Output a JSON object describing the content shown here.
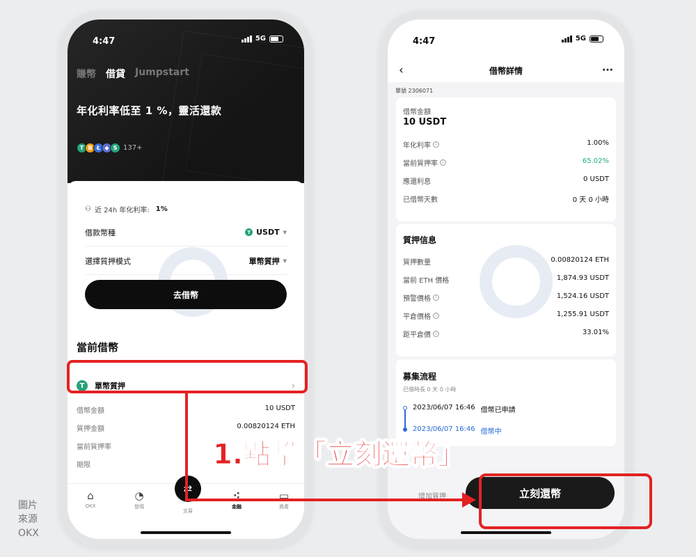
{
  "left_screen": {
    "time": "4:47",
    "network": "5G",
    "tabs": [
      "賺幣",
      "借貸",
      "Jumpstart"
    ],
    "headline": "年化利率低至 1 %，靈活還款",
    "coin_icons": [
      {
        "symbol": "T",
        "color": "#26a17b"
      },
      {
        "symbol": "B",
        "color": "#f0a11a"
      },
      {
        "symbol": "Ł",
        "color": "#3b6fd8"
      },
      {
        "symbol": "◆",
        "color": "#5b6fd0"
      },
      {
        "symbol": "S",
        "color": "#26a17b"
      }
    ],
    "coin_count": "137+",
    "rate_label": "近 24h 年化利率:",
    "rate_value": "1%",
    "loan_currency_label": "借款幣種",
    "loan_currency_value": "USDT",
    "collateral_mode_label": "選擇質押模式",
    "collateral_mode_value": "單幣質押",
    "go_borrow_label": "去借幣",
    "current_loans_title": "當前借幣",
    "loan_item_label": "單幣質押",
    "loan_details": [
      {
        "label": "借幣金額",
        "value": "10 USDT"
      },
      {
        "label": "質押金額",
        "value": "0.00820124 ETH"
      },
      {
        "label": "當前質押率",
        "value": ""
      },
      {
        "label": "期限",
        "value": ""
      }
    ],
    "tabbar": [
      {
        "label": "OKX",
        "icon": "home-icon"
      },
      {
        "label": "發現",
        "icon": "discover-icon"
      },
      {
        "label": "交易",
        "icon": "trade-icon"
      },
      {
        "label": "金融",
        "icon": "finance-icon"
      },
      {
        "label": "資產",
        "icon": "wallet-icon"
      }
    ]
  },
  "right_screen": {
    "time": "4:47",
    "network": "5G",
    "nav_title": "借幣詳情",
    "order_id": "單號 2306071",
    "loan_amount_label": "借幣金額",
    "loan_amount_value": "10 USDT",
    "loan_rows": [
      {
        "label": "年化利率",
        "value": "1.00%",
        "info": true
      },
      {
        "label": "當前質押率",
        "value": "65.02%",
        "info": true,
        "color": "#1fae82"
      },
      {
        "label": "應還利息",
        "value": "0 USDT",
        "info": false
      },
      {
        "label": "已借幣天數",
        "value": "0 天 0 小時",
        "info": false
      }
    ],
    "collateral_title": "質押信息",
    "collateral_rows": [
      {
        "label": "質押數量",
        "value": "0.00820124 ETH",
        "info": false
      },
      {
        "label": "當前 ETH 價格",
        "value": "1,874.93 USDT",
        "info": false
      },
      {
        "label": "預警價格",
        "value": "1,524.16 USDT",
        "info": true
      },
      {
        "label": "平倉價格",
        "value": "1,255.91 USDT",
        "info": true
      },
      {
        "label": "距平倉價",
        "value": "33.01%",
        "info": true
      }
    ],
    "process_title": "募集流程",
    "process_duration": "已借時長 0 天 0 小時",
    "timeline": [
      {
        "time": "2023/06/07 16:46",
        "event": "借幣已申請"
      },
      {
        "time": "2023/06/07 16:46",
        "event": "借幣中"
      }
    ],
    "repay_label": "立刻還幣",
    "faded_label": "增加質押"
  },
  "annotation": {
    "instruction": "1.點擊「立刻還幣」",
    "color": "#e32222"
  },
  "source_credit": [
    "圖片",
    "來源",
    "OKX"
  ]
}
